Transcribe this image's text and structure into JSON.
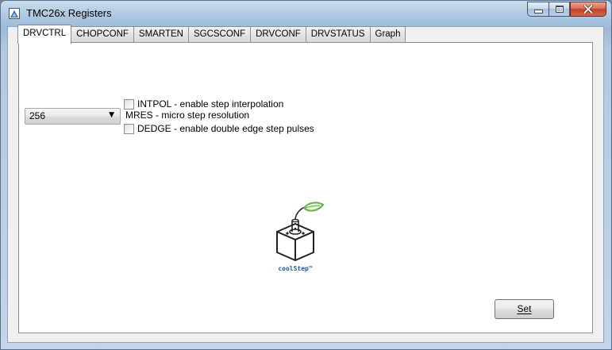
{
  "window": {
    "title": "TMC26x Registers"
  },
  "tabs": [
    {
      "label": "DRVCTRL",
      "active": true
    },
    {
      "label": "CHOPCONF",
      "active": false
    },
    {
      "label": "SMARTEN",
      "active": false
    },
    {
      "label": "SGCSCONF",
      "active": false
    },
    {
      "label": "DRVCONF",
      "active": false
    },
    {
      "label": "DRVSTATUS",
      "active": false
    },
    {
      "label": "Graph",
      "active": false
    }
  ],
  "drvctrl": {
    "intpol": {
      "label": "INTPOL - enable step interpolation",
      "checked": false
    },
    "dedge": {
      "label": "DEDGE - enable double edge step pulses",
      "checked": false
    },
    "mres": {
      "value": "256",
      "label": "MRES - micro step resolution"
    },
    "set_button": "Set"
  },
  "logo": {
    "text": "coolStep™"
  },
  "colors": {
    "accent": "#2a56a0",
    "leaf": "#66b04a",
    "close": "#c2442a"
  }
}
